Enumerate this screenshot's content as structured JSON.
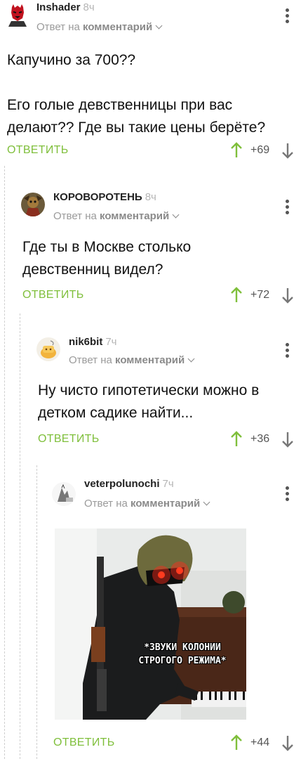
{
  "comments": [
    {
      "username": "Inshader",
      "time": "8ч",
      "reply_to_prefix": "Ответ на",
      "reply_to_link": "комментарий",
      "text_lines": [
        "Капучино за 700??",
        "",
        "Его голые девственницы при вас",
        "делают?? Где вы такие цены берёте?"
      ],
      "reply_label": "ОТВЕТИТЬ",
      "rating": "+69"
    },
    {
      "username": "КОРОВОРОТЕНЬ",
      "time": "8ч",
      "reply_to_prefix": "Ответ на",
      "reply_to_link": "комментарий",
      "text_lines": [
        "Где ты в Москве столько",
        "девственниц видел?"
      ],
      "reply_label": "ОТВЕТИТЬ",
      "rating": "+72"
    },
    {
      "username": "nik6bit",
      "time": "7ч",
      "reply_to_prefix": "Ответ на",
      "reply_to_link": "комментарий",
      "text_lines": [
        "Ну чисто гипотетически можно в",
        "детком садике найти..."
      ],
      "reply_label": "ОТВЕТИТЬ",
      "rating": "+36"
    },
    {
      "username": "veterpolunochi",
      "time": "7ч",
      "reply_to_prefix": "Ответ на",
      "reply_to_link": "комментарий",
      "image_caption_lines": [
        "*ЗВУКИ КОЛОНИИ",
        "СТРОГОГО РЕЖИМА*"
      ],
      "reply_label": "ОТВЕТИТЬ",
      "rating": "+44"
    }
  ],
  "colors": {
    "reply_green": "#7fbf3b",
    "upvote_green": "#7fbf3b",
    "downvote_gray": "#777777",
    "thread_line": "#cfcfcf"
  },
  "icons": {
    "more": "more-vertical-icon",
    "upvote": "arrow-up-icon",
    "downvote": "arrow-down-icon",
    "chevron": "chevron-down-icon"
  }
}
